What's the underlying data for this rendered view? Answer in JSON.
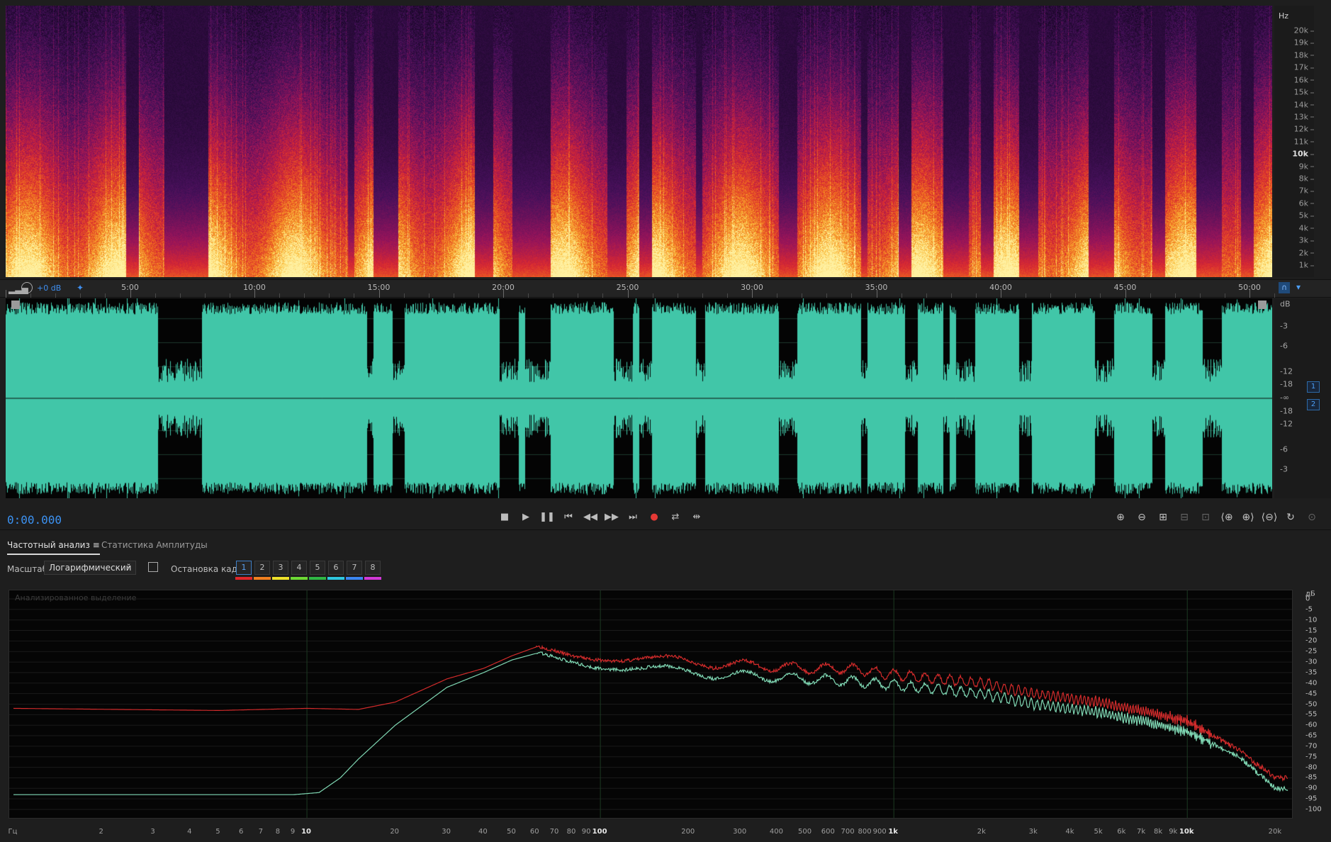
{
  "spectrogram": {
    "unit": "Hz",
    "ticks": [
      {
        "label": "20k",
        "bold": false
      },
      {
        "label": "19k",
        "bold": false
      },
      {
        "label": "18k",
        "bold": false
      },
      {
        "label": "17k",
        "bold": false
      },
      {
        "label": "16k",
        "bold": false
      },
      {
        "label": "15k",
        "bold": false
      },
      {
        "label": "14k",
        "bold": false
      },
      {
        "label": "13k",
        "bold": false
      },
      {
        "label": "12k",
        "bold": false
      },
      {
        "label": "11k",
        "bold": false
      },
      {
        "label": "10k",
        "bold": true
      },
      {
        "label": "9k",
        "bold": false
      },
      {
        "label": "8k",
        "bold": false
      },
      {
        "label": "7k",
        "bold": false
      },
      {
        "label": "6k",
        "bold": false
      },
      {
        "label": "5k",
        "bold": false
      },
      {
        "label": "4k",
        "bold": false
      },
      {
        "label": "3k",
        "bold": false
      },
      {
        "label": "2k",
        "bold": false
      },
      {
        "label": "1k",
        "bold": false
      }
    ]
  },
  "timeline": {
    "gain": "+0 dB",
    "labels": [
      "5:00",
      "10:00",
      "15:00",
      "20:00",
      "25:00",
      "30:00",
      "35:00",
      "40:00",
      "45:00",
      "50:00"
    ]
  },
  "waveform": {
    "unit": "dB",
    "ticks": [
      "-3",
      "-6",
      "-12",
      "-18",
      "-∞",
      "-18",
      "-12",
      "-6",
      "-3"
    ],
    "channels": [
      "1",
      "2"
    ],
    "color": "#41c6a8"
  },
  "transport": {
    "time": "0:00.000",
    "buttons": [
      "stop",
      "play",
      "pause",
      "go-to-start",
      "rewind",
      "fast-forward",
      "go-to-end",
      "record",
      "loop",
      "skip-selection"
    ]
  },
  "panel": {
    "tabs": [
      {
        "label": "Частотный анализ",
        "active": true
      },
      {
        "label": "Статистика Амплитуды",
        "active": false
      }
    ],
    "scale_label": "Масштаб:",
    "scale_value": "Логарифмический",
    "freeze_label": "Остановка кадра:",
    "frames": [
      {
        "label": "1",
        "color": "#e0262a",
        "active": true
      },
      {
        "label": "2",
        "color": "#f2801f",
        "active": false
      },
      {
        "label": "3",
        "color": "#efe12a",
        "active": false
      },
      {
        "label": "4",
        "color": "#6dda34",
        "active": false
      },
      {
        "label": "5",
        "color": "#2fb845",
        "active": false
      },
      {
        "label": "6",
        "color": "#2ec8e0",
        "active": false
      },
      {
        "label": "7",
        "color": "#3b86f2",
        "active": false
      },
      {
        "label": "8",
        "color": "#d238d8",
        "active": false
      }
    ]
  },
  "frequency_plot": {
    "note": "Анализированное выделение",
    "db_unit": "дБ",
    "db_ticks": [
      "0",
      "-5",
      "-10",
      "-15",
      "-20",
      "-25",
      "-30",
      "-35",
      "-40",
      "-45",
      "-50",
      "-55",
      "-60",
      "-65",
      "-70",
      "-75",
      "-80",
      "-85",
      "-90",
      "-95",
      "-100"
    ],
    "x_unit": "Гц",
    "x_ticks": [
      {
        "label": "2",
        "hz": 2
      },
      {
        "label": "3",
        "hz": 3
      },
      {
        "label": "4",
        "hz": 4
      },
      {
        "label": "5",
        "hz": 5
      },
      {
        "label": "6",
        "hz": 6
      },
      {
        "label": "7",
        "hz": 7
      },
      {
        "label": "8",
        "hz": 8
      },
      {
        "label": "9",
        "hz": 9
      },
      {
        "label": "10",
        "hz": 10,
        "bold": true
      },
      {
        "label": "20",
        "hz": 20
      },
      {
        "label": "30",
        "hz": 30
      },
      {
        "label": "40",
        "hz": 40
      },
      {
        "label": "50",
        "hz": 50
      },
      {
        "label": "60",
        "hz": 60
      },
      {
        "label": "70",
        "hz": 70
      },
      {
        "label": "80",
        "hz": 80
      },
      {
        "label": "90",
        "hz": 90
      },
      {
        "label": "100",
        "hz": 100,
        "bold": true
      },
      {
        "label": "200",
        "hz": 200
      },
      {
        "label": "300",
        "hz": 300
      },
      {
        "label": "400",
        "hz": 400
      },
      {
        "label": "500",
        "hz": 500
      },
      {
        "label": "600",
        "hz": 600
      },
      {
        "label": "700",
        "hz": 700
      },
      {
        "label": "800",
        "hz": 800
      },
      {
        "label": "900",
        "hz": 900
      },
      {
        "label": "1k",
        "hz": 1000,
        "bold": true
      },
      {
        "label": "2k",
        "hz": 2000
      },
      {
        "label": "3k",
        "hz": 3000
      },
      {
        "label": "4k",
        "hz": 4000
      },
      {
        "label": "5k",
        "hz": 5000
      },
      {
        "label": "6k",
        "hz": 6000
      },
      {
        "label": "7k",
        "hz": 7000
      },
      {
        "label": "8k",
        "hz": 8000
      },
      {
        "label": "9k",
        "hz": 9000
      },
      {
        "label": "10k",
        "hz": 10000,
        "bold": true
      },
      {
        "label": "20k",
        "hz": 20000
      }
    ],
    "series": [
      {
        "color": "#d12b2b",
        "points": [
          [
            1,
            -52
          ],
          [
            5,
            -53
          ],
          [
            10,
            -52
          ],
          [
            15,
            -52.5
          ],
          [
            20,
            -49
          ],
          [
            30,
            -38
          ],
          [
            40,
            -33
          ],
          [
            50,
            -27
          ],
          [
            60,
            -23
          ],
          [
            80,
            -26
          ],
          [
            100,
            -27
          ],
          [
            200,
            -30
          ],
          [
            500,
            -33
          ],
          [
            700,
            -33
          ],
          [
            1000,
            -36
          ],
          [
            2000,
            -40
          ],
          [
            3000,
            -45
          ],
          [
            5000,
            -49
          ],
          [
            7000,
            -53
          ],
          [
            10000,
            -58
          ],
          [
            15000,
            -72
          ],
          [
            20000,
            -85
          ]
        ]
      },
      {
        "color": "#7fd7b3",
        "points": [
          [
            1,
            -93
          ],
          [
            5,
            -93
          ],
          [
            9,
            -93
          ],
          [
            11,
            -92
          ],
          [
            13,
            -85
          ],
          [
            15,
            -76
          ],
          [
            20,
            -60
          ],
          [
            30,
            -42
          ],
          [
            40,
            -35
          ],
          [
            50,
            -29
          ],
          [
            60,
            -26
          ],
          [
            80,
            -29
          ],
          [
            100,
            -31
          ],
          [
            200,
            -35
          ],
          [
            500,
            -38
          ],
          [
            700,
            -39
          ],
          [
            1000,
            -41
          ],
          [
            2000,
            -45
          ],
          [
            3000,
            -50
          ],
          [
            5000,
            -54
          ],
          [
            7000,
            -58
          ],
          [
            10000,
            -63
          ],
          [
            15000,
            -75
          ],
          [
            20000,
            -90
          ]
        ]
      }
    ]
  }
}
